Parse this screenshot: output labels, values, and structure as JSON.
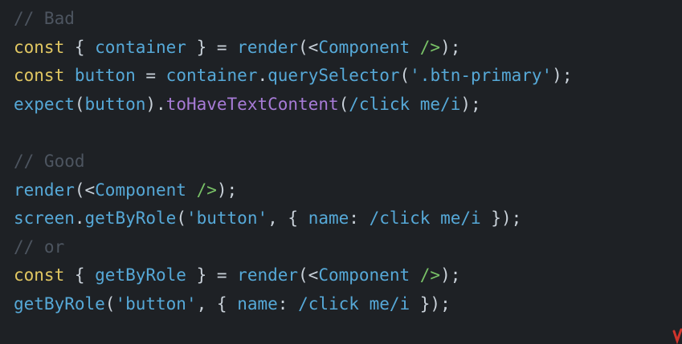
{
  "code": {
    "lines": [
      [
        {
          "t": "// Bad",
          "c": "comment"
        }
      ],
      [
        {
          "t": "const",
          "c": "keyword"
        },
        {
          "t": " { ",
          "c": "punct"
        },
        {
          "t": "container",
          "c": "default"
        },
        {
          "t": " } = ",
          "c": "punct"
        },
        {
          "t": "render",
          "c": "default"
        },
        {
          "t": "(<",
          "c": "punct"
        },
        {
          "t": "Component",
          "c": "default"
        },
        {
          "t": " />",
          "c": "jsx"
        },
        {
          "t": ");",
          "c": "punct"
        }
      ],
      [
        {
          "t": "const",
          "c": "keyword"
        },
        {
          "t": " button",
          "c": "default"
        },
        {
          "t": " = ",
          "c": "punct"
        },
        {
          "t": "container",
          "c": "default"
        },
        {
          "t": ".",
          "c": "punct"
        },
        {
          "t": "querySelector",
          "c": "default"
        },
        {
          "t": "(",
          "c": "punct"
        },
        {
          "t": "'.btn-primary'",
          "c": "string"
        },
        {
          "t": ");",
          "c": "punct"
        }
      ],
      [
        {
          "t": "expect",
          "c": "default"
        },
        {
          "t": "(",
          "c": "punct"
        },
        {
          "t": "button",
          "c": "default"
        },
        {
          "t": ").",
          "c": "punct"
        },
        {
          "t": "toHaveTextContent",
          "c": "method"
        },
        {
          "t": "(",
          "c": "punct"
        },
        {
          "t": "/click me/i",
          "c": "string"
        },
        {
          "t": ");",
          "c": "punct"
        }
      ],
      [],
      [
        {
          "t": "// Good",
          "c": "comment"
        }
      ],
      [
        {
          "t": "render",
          "c": "default"
        },
        {
          "t": "(<",
          "c": "punct"
        },
        {
          "t": "Component",
          "c": "default"
        },
        {
          "t": " />",
          "c": "jsx"
        },
        {
          "t": ");",
          "c": "punct"
        }
      ],
      [
        {
          "t": "screen",
          "c": "default"
        },
        {
          "t": ".",
          "c": "punct"
        },
        {
          "t": "getByRole",
          "c": "default"
        },
        {
          "t": "(",
          "c": "punct"
        },
        {
          "t": "'button'",
          "c": "string"
        },
        {
          "t": ", { ",
          "c": "punct"
        },
        {
          "t": "name",
          "c": "default"
        },
        {
          "t": ": ",
          "c": "punct"
        },
        {
          "t": "/click me/i",
          "c": "string"
        },
        {
          "t": " });",
          "c": "punct"
        }
      ],
      [
        {
          "t": "// or",
          "c": "comment"
        }
      ],
      [
        {
          "t": "const",
          "c": "keyword"
        },
        {
          "t": " { ",
          "c": "punct"
        },
        {
          "t": "getByRole",
          "c": "default"
        },
        {
          "t": " } = ",
          "c": "punct"
        },
        {
          "t": "render",
          "c": "default"
        },
        {
          "t": "(<",
          "c": "punct"
        },
        {
          "t": "Component",
          "c": "default"
        },
        {
          "t": " />",
          "c": "jsx"
        },
        {
          "t": ");",
          "c": "punct"
        }
      ],
      [
        {
          "t": "getByRole",
          "c": "default"
        },
        {
          "t": "(",
          "c": "punct"
        },
        {
          "t": "'button'",
          "c": "string"
        },
        {
          "t": ", { ",
          "c": "punct"
        },
        {
          "t": "name",
          "c": "default"
        },
        {
          "t": ": ",
          "c": "punct"
        },
        {
          "t": "/click me/i",
          "c": "string"
        },
        {
          "t": " });",
          "c": "punct"
        }
      ]
    ]
  },
  "theme": {
    "background": "#1e2125",
    "comment": "#4d5560",
    "keyword": "#e2c862",
    "identifier": "#56a9d8",
    "punctuation": "#c9d1d9",
    "method": "#a77bd6",
    "jsx": "#79c267",
    "corner_accent": "#d0342c"
  },
  "corner_mark": {
    "icon": "red-cursor-mark-icon"
  }
}
